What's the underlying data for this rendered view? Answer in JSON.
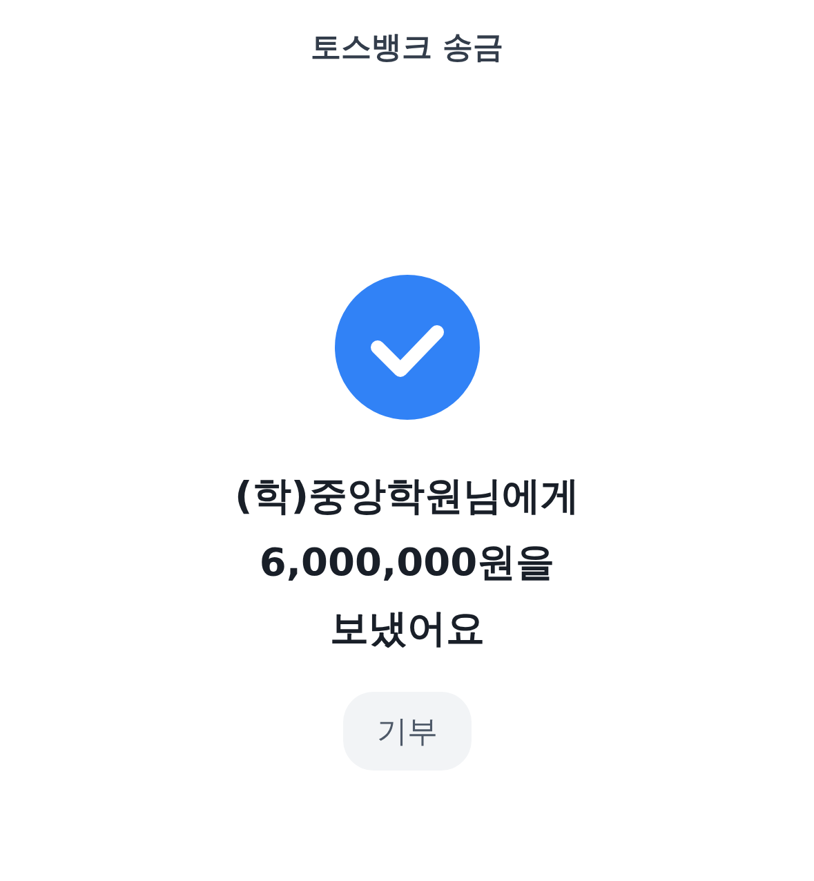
{
  "header": {
    "title": "토스뱅크 송금"
  },
  "result": {
    "kind": "success",
    "message": "(학)중앙학원님에게\n6,000,000원을\n보냈어요"
  },
  "buttons": [
    {
      "label": "기부"
    }
  ]
}
